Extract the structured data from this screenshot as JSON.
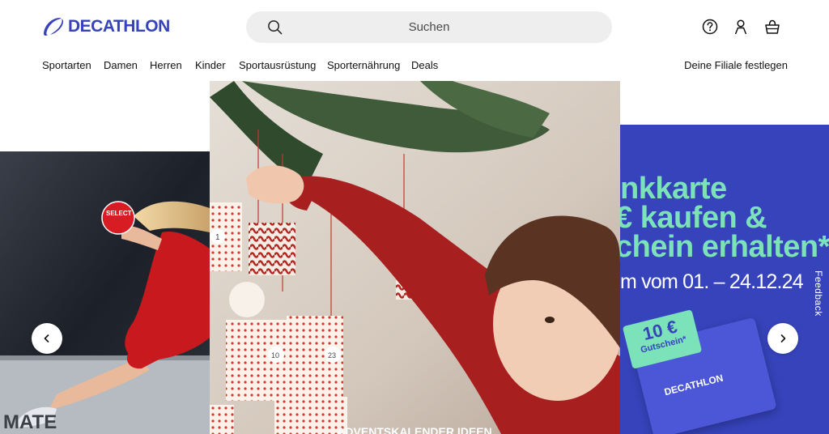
{
  "brand": {
    "name": "DECATHLON",
    "color": "#3643ba"
  },
  "search": {
    "placeholder": "Suchen",
    "icon": "search-icon"
  },
  "header_icons": [
    {
      "name": "help-icon"
    },
    {
      "name": "account-icon"
    },
    {
      "name": "cart-icon"
    }
  ],
  "nav": {
    "items": [
      {
        "label": "Sportarten"
      },
      {
        "label": "Damen"
      },
      {
        "label": "Herren"
      },
      {
        "label": "Kinder"
      },
      {
        "label": "Sportausrüstung"
      },
      {
        "label": "Sporternährung"
      },
      {
        "label": "Deals"
      }
    ],
    "store_link": "Deine Filiale festlegen"
  },
  "carousel": {
    "left_slide": {
      "wall_text": "MATE",
      "ball_text": "SELECT"
    },
    "center_slide": {
      "caption": "ADVENTSKALENDER IDEEN",
      "tags": [
        "1",
        "10",
        "23"
      ]
    },
    "right_slide": {
      "line1": "nkkarte",
      "line2": "€ kaufen &",
      "line3": "chein erhalten*",
      "line4": "m vom 01. – 24.12.24",
      "voucher_amount": "10 €",
      "voucher_label": "Gutschein*",
      "card_logo": "DECATHLON",
      "accent": "#7ce2b9",
      "background": "#3643ba"
    },
    "prev_icon": "chevron-left-icon",
    "next_icon": "chevron-right-icon"
  },
  "feedback": {
    "label": "Feedback"
  }
}
